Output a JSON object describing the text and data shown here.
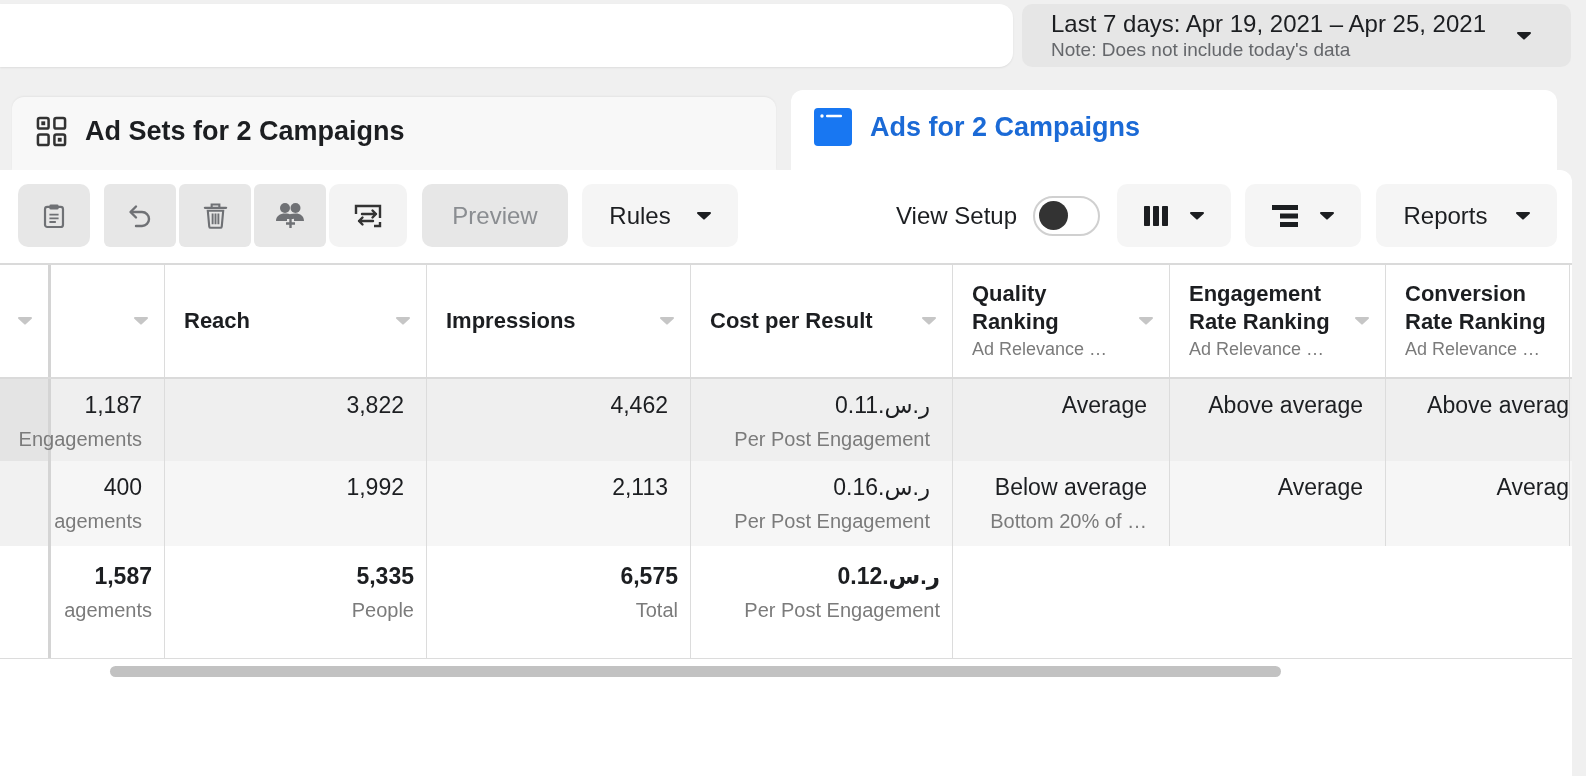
{
  "date_range": {
    "label": "Last 7 days: Apr 19, 2021 – Apr 25, 2021",
    "note": "Note: Does not include today's data"
  },
  "tabs": [
    {
      "label": "Ad Sets for 2 Campaigns",
      "selected": false
    },
    {
      "label": "Ads for 2 Campaigns",
      "selected": true
    }
  ],
  "toolbar": {
    "icon_buttons": [
      {
        "disabled": true
      },
      {
        "disabled": true
      },
      {
        "disabled": true
      },
      {
        "disabled": true
      },
      {
        "disabled": false
      }
    ],
    "buttons": [
      {
        "label": "Preview",
        "disabled": true,
        "dropdown": false
      },
      {
        "label": "Rules",
        "disabled": false,
        "dropdown": true
      }
    ],
    "view_setup": {
      "label": "View Setup",
      "on": false
    },
    "reports_button": {
      "label": "Reports"
    }
  },
  "table": {
    "columns": [
      {
        "sort_menu": true
      },
      {
        "sort_menu": true
      },
      {
        "label": "Reach",
        "sort_menu": true
      },
      {
        "label": "Impressions",
        "sort_menu": true
      },
      {
        "label": "Cost per Result",
        "sort_menu": true
      },
      {
        "label": "Quality Ranking",
        "sublabel": "Ad Relevance …",
        "sort_menu": true
      },
      {
        "label": "Engagement Rate Ranking",
        "sublabel": "Ad Relevance …",
        "sort_menu": true
      },
      {
        "label": "Conversion Rate Ranking",
        "sublabel": "Ad Relevance …",
        "sort_menu": false
      }
    ],
    "rows": [
      {
        "highlighted": true,
        "cells": [
          "",
          {
            "value": "1,187",
            "sub": "Engagements"
          },
          {
            "value": "3,822"
          },
          {
            "value": "4,462"
          },
          {
            "value": "ر.س.0.11",
            "sub": "Per Post Engagement"
          },
          {
            "value": "Average"
          },
          {
            "value": "Above average"
          },
          {
            "value": "Above averag"
          }
        ]
      },
      {
        "highlighted": false,
        "cells": [
          "",
          {
            "value": "400",
            "sub": "agements"
          },
          {
            "value": "1,992"
          },
          {
            "value": "2,113"
          },
          {
            "value": "ر.س.0.16",
            "sub": "Per Post Engagement"
          },
          {
            "value": "Below average",
            "sub": "Bottom 20% of …"
          },
          {
            "value": "Average"
          },
          {
            "value": "Averag"
          }
        ]
      }
    ],
    "total_row": {
      "cells": [
        "",
        {
          "value": "1,587",
          "sub": "agements"
        },
        {
          "value": "5,335",
          "sub": "People"
        },
        {
          "value": "6,575",
          "sub": "Total"
        },
        {
          "value": "ر.س.0.12",
          "sub": "Per Post Engagement"
        }
      ]
    }
  }
}
